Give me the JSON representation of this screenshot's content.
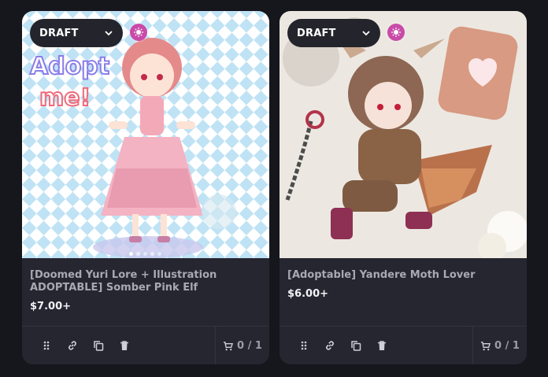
{
  "listings": [
    {
      "status": "DRAFT",
      "title": "[Doomed Yuri Lore + Illustration ADOPTABLE] Somber Pink Elf",
      "price": "$7.00+",
      "stock": "0 / 1",
      "image_overlay_text": [
        "Adopt",
        "me!"
      ]
    },
    {
      "status": "DRAFT",
      "title": "[Adoptable] Yandere Moth Lover",
      "price": "$6.00+",
      "stock": "0 / 1"
    }
  ],
  "icons": {
    "status_chevron": "chevron-down-icon",
    "badge": "sparkle-icon",
    "tools": [
      "drag-handle-icon",
      "link-icon",
      "duplicate-icon",
      "trash-icon"
    ],
    "stock": "cart-icon"
  },
  "colors": {
    "page_bg": "#16161d",
    "card_bg": "#262630",
    "badge": "#c94aa8",
    "title_text": "#a9a9b4"
  }
}
